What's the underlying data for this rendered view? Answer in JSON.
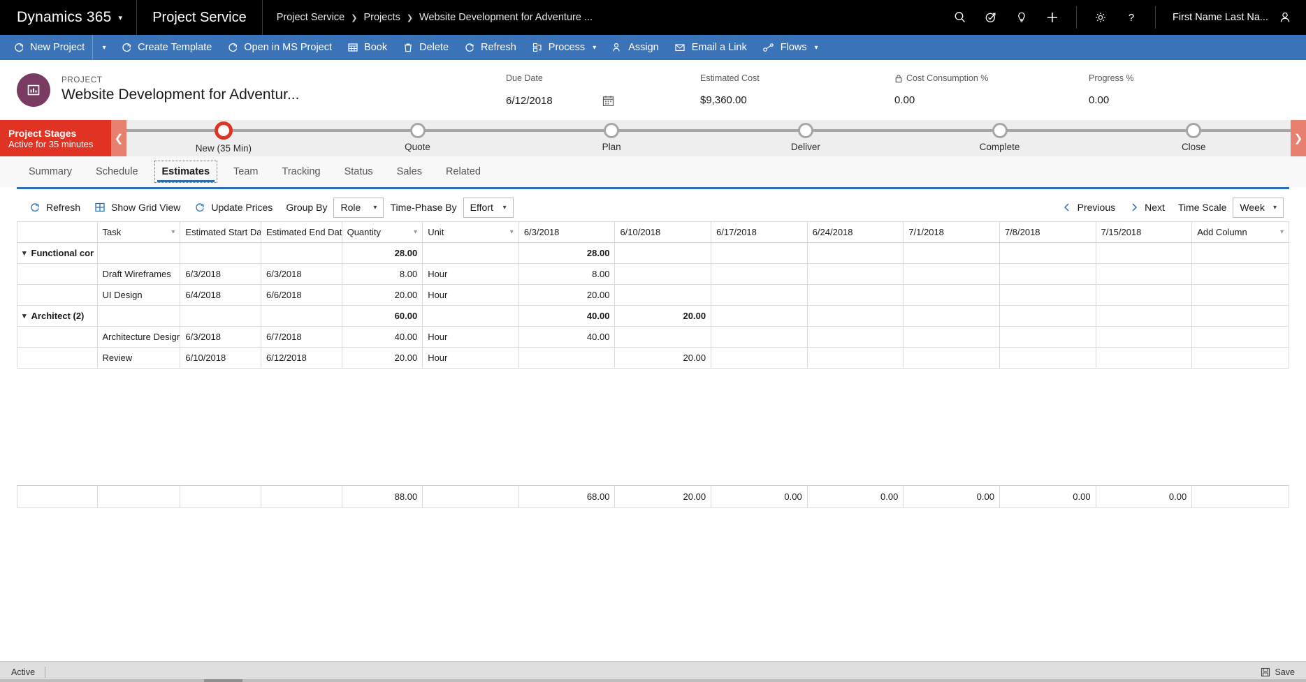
{
  "topnav": {
    "brand": "Dynamics 365",
    "brand_caret": "chevron-down-icon",
    "app_name": "Project Service",
    "breadcrumb": [
      {
        "label": "Project Service"
      },
      {
        "label": "Projects"
      },
      {
        "label": "Website Development for Adventure ..."
      }
    ],
    "icons": [
      {
        "name": "search-icon"
      },
      {
        "name": "assistant-icon"
      },
      {
        "name": "lightbulb-icon"
      },
      {
        "name": "quick-create-plus-icon"
      },
      {
        "name": "gear-icon"
      },
      {
        "name": "help-question-icon"
      }
    ],
    "user_name": "First Name Last Na...",
    "user_avatar": "person-icon"
  },
  "command_bar": {
    "items": [
      {
        "label": "New Project",
        "icon": "refresh-circle-icon",
        "has_split": true
      },
      {
        "label": "Create Template",
        "icon": "refresh-circle-icon"
      },
      {
        "label": "Open in MS Project",
        "icon": "refresh-circle-icon"
      },
      {
        "label": "Book",
        "icon": "grid-table-icon"
      },
      {
        "label": "Delete",
        "icon": "trash-icon"
      },
      {
        "label": "Refresh",
        "icon": "refresh-icon"
      },
      {
        "label": "Process",
        "icon": "process-icon",
        "caret": true
      },
      {
        "label": "Assign",
        "icon": "person-assign-icon"
      },
      {
        "label": "Email a Link",
        "icon": "email-icon"
      },
      {
        "label": "Flows",
        "icon": "flows-icon",
        "caret": true
      }
    ]
  },
  "record_header": {
    "kicker": "PROJECT",
    "title": "Website Development for Adventur...",
    "avatar_icon": "project-icon",
    "fields": [
      {
        "label": "Due Date",
        "value": "6/12/2018",
        "icon": "calendar-icon"
      },
      {
        "label": "Estimated Cost",
        "value": "$9,360.00"
      },
      {
        "label": "Cost Consumption %",
        "value": "0.00",
        "lock": "lock-icon"
      },
      {
        "label": "Progress %",
        "value": "0.00"
      }
    ]
  },
  "process_flow": {
    "title": "Project Stages",
    "subtitle": "Active for 35 minutes",
    "prev_icon": "chevron-left-icon",
    "next_icon": "chevron-right-icon",
    "stages": [
      {
        "label": "New  (35 Min)",
        "active": true
      },
      {
        "label": "Quote",
        "active": false
      },
      {
        "label": "Plan",
        "active": false
      },
      {
        "label": "Deliver",
        "active": false
      },
      {
        "label": "Complete",
        "active": false
      },
      {
        "label": "Close",
        "active": false
      }
    ],
    "accent_color": "#e03323"
  },
  "tabs": [
    {
      "label": "Summary",
      "selected": false
    },
    {
      "label": "Schedule",
      "selected": false
    },
    {
      "label": "Estimates",
      "selected": true
    },
    {
      "label": "Team",
      "selected": false
    },
    {
      "label": "Tracking",
      "selected": false
    },
    {
      "label": "Status",
      "selected": false
    },
    {
      "label": "Sales",
      "selected": false
    },
    {
      "label": "Related",
      "selected": false
    }
  ],
  "grid_toolbar": {
    "refresh": "Refresh",
    "show_grid_view": "Show Grid View",
    "update_prices": "Update Prices",
    "group_by_label": "Group By",
    "group_by_value": "Role",
    "time_phase_label": "Time-Phase By",
    "time_phase_value": "Effort",
    "previous": "Previous",
    "next": "Next",
    "time_scale_label": "Time Scale",
    "time_scale_value": "Week"
  },
  "grid": {
    "columns": [
      {
        "label": "",
        "caret": false,
        "key": "sel"
      },
      {
        "label": "Task",
        "caret": true,
        "key": "task"
      },
      {
        "label": "Estimated Start Date",
        "caret": true,
        "key": "start"
      },
      {
        "label": "Estimated End Date",
        "caret": true,
        "key": "end"
      },
      {
        "label": "Quantity",
        "caret": true,
        "key": "qty"
      },
      {
        "label": "Unit",
        "caret": true,
        "key": "unit"
      },
      {
        "label": "6/3/2018",
        "caret": false,
        "key": "w1"
      },
      {
        "label": "6/10/2018",
        "caret": false,
        "key": "w2"
      },
      {
        "label": "6/17/2018",
        "caret": false,
        "key": "w3"
      },
      {
        "label": "6/24/2018",
        "caret": false,
        "key": "w4"
      },
      {
        "label": "7/1/2018",
        "caret": false,
        "key": "w5"
      },
      {
        "label": "7/8/2018",
        "caret": false,
        "key": "w6"
      },
      {
        "label": "7/15/2018",
        "caret": false,
        "key": "w7"
      },
      {
        "label": "Add Column",
        "caret": true,
        "key": "add"
      }
    ],
    "rows": [
      {
        "type": "group",
        "caret": "chevron-down-icon",
        "group_label": "Functional cor",
        "task": "",
        "start": "",
        "end": "",
        "qty": "28.00",
        "unit": "",
        "w1": "28.00",
        "w2": "",
        "w3": "",
        "w4": "",
        "w5": "",
        "w6": "",
        "w7": ""
      },
      {
        "type": "task",
        "group_label": "",
        "task": "Draft Wireframes",
        "start": "6/3/2018",
        "end": "6/3/2018",
        "qty": "8.00",
        "unit": "Hour",
        "w1": "8.00",
        "w2": "",
        "w3": "",
        "w4": "",
        "w5": "",
        "w6": "",
        "w7": ""
      },
      {
        "type": "task",
        "group_label": "",
        "task": "UI Design",
        "start": "6/4/2018",
        "end": "6/6/2018",
        "qty": "20.00",
        "unit": "Hour",
        "w1": "20.00",
        "w2": "",
        "w3": "",
        "w4": "",
        "w5": "",
        "w6": "",
        "w7": ""
      },
      {
        "type": "group",
        "caret": "chevron-down-icon",
        "group_label": "Architect (2)",
        "task": "",
        "start": "",
        "end": "",
        "qty": "60.00",
        "unit": "",
        "w1": "40.00",
        "w2": "20.00",
        "w3": "",
        "w4": "",
        "w5": "",
        "w6": "",
        "w7": ""
      },
      {
        "type": "task",
        "group_label": "",
        "task": "Architecture Desigr",
        "start": "6/3/2018",
        "end": "6/7/2018",
        "qty": "40.00",
        "unit": "Hour",
        "w1": "40.00",
        "w2": "",
        "w3": "",
        "w4": "",
        "w5": "",
        "w6": "",
        "w7": ""
      },
      {
        "type": "task",
        "group_label": "",
        "task": "Review",
        "start": "6/10/2018",
        "end": "6/12/2018",
        "qty": "20.00",
        "unit": "Hour",
        "w1": "",
        "w2": "20.00",
        "w3": "",
        "w4": "",
        "w5": "",
        "w6": "",
        "w7": ""
      }
    ],
    "totals": {
      "sel": "",
      "task": "",
      "start": "",
      "end": "",
      "qty": "88.00",
      "unit": "",
      "w1": "68.00",
      "w2": "20.00",
      "w3": "0.00",
      "w4": "0.00",
      "w5": "0.00",
      "w6": "0.00",
      "w7": "0.00",
      "add": ""
    }
  },
  "statusbar": {
    "status": "Active",
    "save_label": "Save",
    "save_icon": "save-disk-icon"
  }
}
